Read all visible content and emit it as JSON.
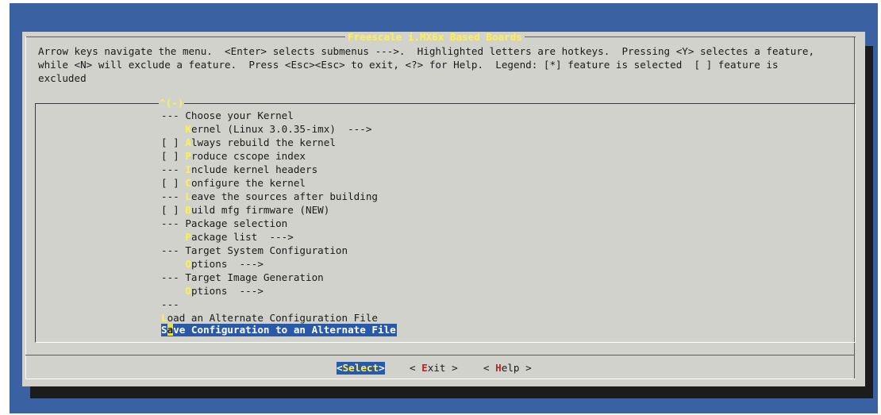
{
  "dialog": {
    "title": "Freescale i.MX6x Based Boards",
    "help_text": "Arrow keys navigate the menu.  <Enter> selects submenus --->.  Highlighted letters are hotkeys.  Pressing <Y> selectes a feature,\nwhile <N> will exclude a feature.  Press <Esc><Esc> to exit, <?> for Help.  Legend: [*] feature is selected  [ ] feature is\nexcluded"
  },
  "menu": {
    "scroll_indicator": "^(-)",
    "items": [
      {
        "prefix": "--- ",
        "hotkey": "",
        "rest": "Choose your Kernel"
      },
      {
        "prefix": "    ",
        "hotkey": "K",
        "rest": "ernel (Linux 3.0.35-imx)  --->"
      },
      {
        "prefix": "[ ] ",
        "hotkey": "A",
        "rest": "lways rebuild the kernel"
      },
      {
        "prefix": "[ ] ",
        "hotkey": "P",
        "rest": "roduce cscope index"
      },
      {
        "prefix": "--- ",
        "hotkey": "I",
        "rest": "nclude kernel headers"
      },
      {
        "prefix": "[ ] ",
        "hotkey": "C",
        "rest": "onfigure the kernel"
      },
      {
        "prefix": "--- ",
        "hotkey": "L",
        "rest": "eave the sources after building"
      },
      {
        "prefix": "[ ] ",
        "hotkey": "B",
        "rest": "uild mfg firmware (NEW)"
      },
      {
        "prefix": "--- ",
        "hotkey": "",
        "rest": "Package selection"
      },
      {
        "prefix": "    ",
        "hotkey": "P",
        "rest": "ackage list  --->"
      },
      {
        "prefix": "--- ",
        "hotkey": "",
        "rest": "Target System Configuration"
      },
      {
        "prefix": "    ",
        "hotkey": "O",
        "rest": "ptions  --->"
      },
      {
        "prefix": "--- ",
        "hotkey": "",
        "rest": "Target Image Generation"
      },
      {
        "prefix": "    ",
        "hotkey": "O",
        "rest": "ptions  --->"
      },
      {
        "prefix": "--- ",
        "hotkey": "",
        "rest": ""
      },
      {
        "prefix": "",
        "hotkey": "L",
        "rest": "oad an Alternate Configuration File"
      },
      {
        "prefix": "S",
        "hotkey": "a",
        "rest": "ve Configuration to an Alternate File",
        "selected": true
      }
    ]
  },
  "buttons": {
    "select": {
      "pre": "<",
      "hotkey": "Select",
      "post": ">"
    },
    "exit": {
      "pre": "< ",
      "hotkey": "E",
      "post": "xit >"
    },
    "help": {
      "pre": "< ",
      "hotkey": "H",
      "post": "elp >"
    }
  },
  "colors": {
    "background": "#3a62a3",
    "dialog": "#d2d2cc",
    "hotkey": "#ffef50",
    "selection": "#2a59a8",
    "button_hotkey": "#c81e1e"
  }
}
